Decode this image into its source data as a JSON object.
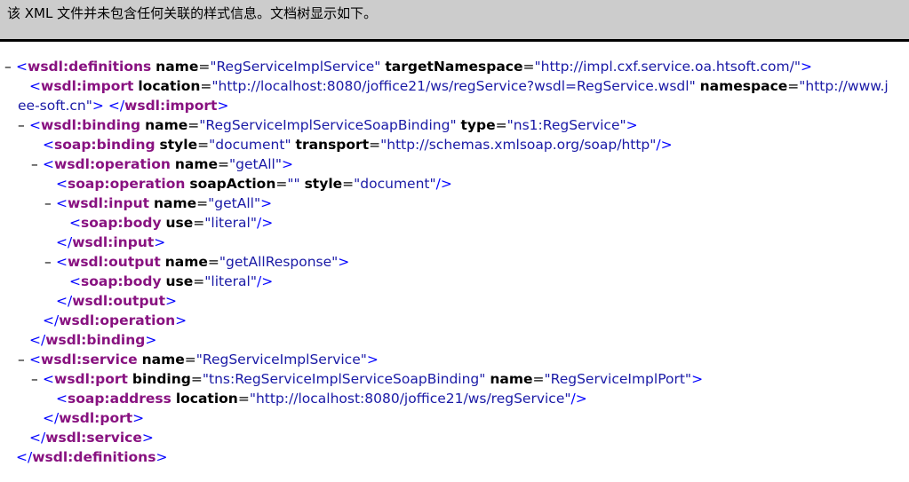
{
  "header": {
    "message": "该 XML 文件并未包含任何关联的样式信息。文档树显示如下。"
  },
  "colors": {
    "tag": "#881280",
    "value": "#1a1aa6",
    "header_bg": "#cccccc"
  },
  "toggle_symbol": "–",
  "lines": [
    {
      "level": 0,
      "toggle": true,
      "tokens": [
        [
          "p",
          "<"
        ],
        [
          "tag",
          "wsdl:definitions"
        ],
        [
          "s",
          " "
        ],
        [
          "attr",
          "name"
        ],
        [
          "eq",
          "="
        ],
        [
          "val",
          "\"RegServiceImplService\""
        ],
        [
          "s",
          " "
        ],
        [
          "attr",
          "targetNamespace"
        ],
        [
          "eq",
          "="
        ],
        [
          "val",
          "\"http://impl.cxf.service.oa.htsoft.com/\""
        ],
        [
          "p",
          ">"
        ]
      ]
    },
    {
      "level": 1,
      "toggle": false,
      "tokens": [
        [
          "p",
          "<"
        ],
        [
          "tag",
          "wsdl:import"
        ],
        [
          "s",
          " "
        ],
        [
          "attr",
          "location"
        ],
        [
          "eq",
          "="
        ],
        [
          "val",
          "\"http://localhost:8080/joffice21/ws/regService?wsdl=RegService.wsdl\""
        ],
        [
          "s",
          " "
        ],
        [
          "attr",
          "namespace"
        ],
        [
          "eq",
          "="
        ],
        [
          "val",
          "\"http://www.jee-soft.cn\""
        ],
        [
          "p",
          ">"
        ],
        [
          "s",
          " "
        ],
        [
          "p",
          "</"
        ],
        [
          "tag",
          "wsdl:import"
        ],
        [
          "p",
          ">"
        ]
      ]
    },
    {
      "level": 1,
      "toggle": true,
      "tokens": [
        [
          "p",
          "<"
        ],
        [
          "tag",
          "wsdl:binding"
        ],
        [
          "s",
          " "
        ],
        [
          "attr",
          "name"
        ],
        [
          "eq",
          "="
        ],
        [
          "val",
          "\"RegServiceImplServiceSoapBinding\""
        ],
        [
          "s",
          " "
        ],
        [
          "attr",
          "type"
        ],
        [
          "eq",
          "="
        ],
        [
          "val",
          "\"ns1:RegService\""
        ],
        [
          "p",
          ">"
        ]
      ]
    },
    {
      "level": 2,
      "toggle": false,
      "tokens": [
        [
          "p",
          "<"
        ],
        [
          "tag",
          "soap:binding"
        ],
        [
          "s",
          " "
        ],
        [
          "attr",
          "style"
        ],
        [
          "eq",
          "="
        ],
        [
          "val",
          "\"document\""
        ],
        [
          "s",
          " "
        ],
        [
          "attr",
          "transport"
        ],
        [
          "eq",
          "="
        ],
        [
          "val",
          "\"http://schemas.xmlsoap.org/soap/http\""
        ],
        [
          "p",
          "/>"
        ]
      ]
    },
    {
      "level": 2,
      "toggle": true,
      "tokens": [
        [
          "p",
          "<"
        ],
        [
          "tag",
          "wsdl:operation"
        ],
        [
          "s",
          " "
        ],
        [
          "attr",
          "name"
        ],
        [
          "eq",
          "="
        ],
        [
          "val",
          "\"getAll\""
        ],
        [
          "p",
          ">"
        ]
      ]
    },
    {
      "level": 3,
      "toggle": false,
      "tokens": [
        [
          "p",
          "<"
        ],
        [
          "tag",
          "soap:operation"
        ],
        [
          "s",
          " "
        ],
        [
          "attr",
          "soapAction"
        ],
        [
          "eq",
          "="
        ],
        [
          "val",
          "\"\""
        ],
        [
          "s",
          " "
        ],
        [
          "attr",
          "style"
        ],
        [
          "eq",
          "="
        ],
        [
          "val",
          "\"document\""
        ],
        [
          "p",
          "/>"
        ]
      ]
    },
    {
      "level": 3,
      "toggle": true,
      "tokens": [
        [
          "p",
          "<"
        ],
        [
          "tag",
          "wsdl:input"
        ],
        [
          "s",
          " "
        ],
        [
          "attr",
          "name"
        ],
        [
          "eq",
          "="
        ],
        [
          "val",
          "\"getAll\""
        ],
        [
          "p",
          ">"
        ]
      ]
    },
    {
      "level": 4,
      "toggle": false,
      "tokens": [
        [
          "p",
          "<"
        ],
        [
          "tag",
          "soap:body"
        ],
        [
          "s",
          " "
        ],
        [
          "attr",
          "use"
        ],
        [
          "eq",
          "="
        ],
        [
          "val",
          "\"literal\""
        ],
        [
          "p",
          "/>"
        ]
      ]
    },
    {
      "level": 3,
      "toggle": false,
      "tokens": [
        [
          "p",
          "</"
        ],
        [
          "tag",
          "wsdl:input"
        ],
        [
          "p",
          ">"
        ]
      ]
    },
    {
      "level": 3,
      "toggle": true,
      "tokens": [
        [
          "p",
          "<"
        ],
        [
          "tag",
          "wsdl:output"
        ],
        [
          "s",
          " "
        ],
        [
          "attr",
          "name"
        ],
        [
          "eq",
          "="
        ],
        [
          "val",
          "\"getAllResponse\""
        ],
        [
          "p",
          ">"
        ]
      ]
    },
    {
      "level": 4,
      "toggle": false,
      "tokens": [
        [
          "p",
          "<"
        ],
        [
          "tag",
          "soap:body"
        ],
        [
          "s",
          " "
        ],
        [
          "attr",
          "use"
        ],
        [
          "eq",
          "="
        ],
        [
          "val",
          "\"literal\""
        ],
        [
          "p",
          "/>"
        ]
      ]
    },
    {
      "level": 3,
      "toggle": false,
      "tokens": [
        [
          "p",
          "</"
        ],
        [
          "tag",
          "wsdl:output"
        ],
        [
          "p",
          ">"
        ]
      ]
    },
    {
      "level": 2,
      "toggle": false,
      "tokens": [
        [
          "p",
          "</"
        ],
        [
          "tag",
          "wsdl:operation"
        ],
        [
          "p",
          ">"
        ]
      ]
    },
    {
      "level": 1,
      "toggle": false,
      "tokens": [
        [
          "p",
          "</"
        ],
        [
          "tag",
          "wsdl:binding"
        ],
        [
          "p",
          ">"
        ]
      ]
    },
    {
      "level": 1,
      "toggle": true,
      "tokens": [
        [
          "p",
          "<"
        ],
        [
          "tag",
          "wsdl:service"
        ],
        [
          "s",
          " "
        ],
        [
          "attr",
          "name"
        ],
        [
          "eq",
          "="
        ],
        [
          "val",
          "\"RegServiceImplService\""
        ],
        [
          "p",
          ">"
        ]
      ]
    },
    {
      "level": 2,
      "toggle": true,
      "tokens": [
        [
          "p",
          "<"
        ],
        [
          "tag",
          "wsdl:port"
        ],
        [
          "s",
          " "
        ],
        [
          "attr",
          "binding"
        ],
        [
          "eq",
          "="
        ],
        [
          "val",
          "\"tns:RegServiceImplServiceSoapBinding\""
        ],
        [
          "s",
          " "
        ],
        [
          "attr",
          "name"
        ],
        [
          "eq",
          "="
        ],
        [
          "val",
          "\"RegServiceImplPort\""
        ],
        [
          "p",
          ">"
        ]
      ]
    },
    {
      "level": 3,
      "toggle": false,
      "tokens": [
        [
          "p",
          "<"
        ],
        [
          "tag",
          "soap:address"
        ],
        [
          "s",
          " "
        ],
        [
          "attr",
          "location"
        ],
        [
          "eq",
          "="
        ],
        [
          "val",
          "\"http://localhost:8080/joffice21/ws/regService\""
        ],
        [
          "p",
          "/>"
        ]
      ]
    },
    {
      "level": 2,
      "toggle": false,
      "tokens": [
        [
          "p",
          "</"
        ],
        [
          "tag",
          "wsdl:port"
        ],
        [
          "p",
          ">"
        ]
      ]
    },
    {
      "level": 1,
      "toggle": false,
      "tokens": [
        [
          "p",
          "</"
        ],
        [
          "tag",
          "wsdl:service"
        ],
        [
          "p",
          ">"
        ]
      ]
    },
    {
      "level": 0,
      "toggle": false,
      "tokens": [
        [
          "p",
          "</"
        ],
        [
          "tag",
          "wsdl:definitions"
        ],
        [
          "p",
          ">"
        ]
      ]
    }
  ]
}
